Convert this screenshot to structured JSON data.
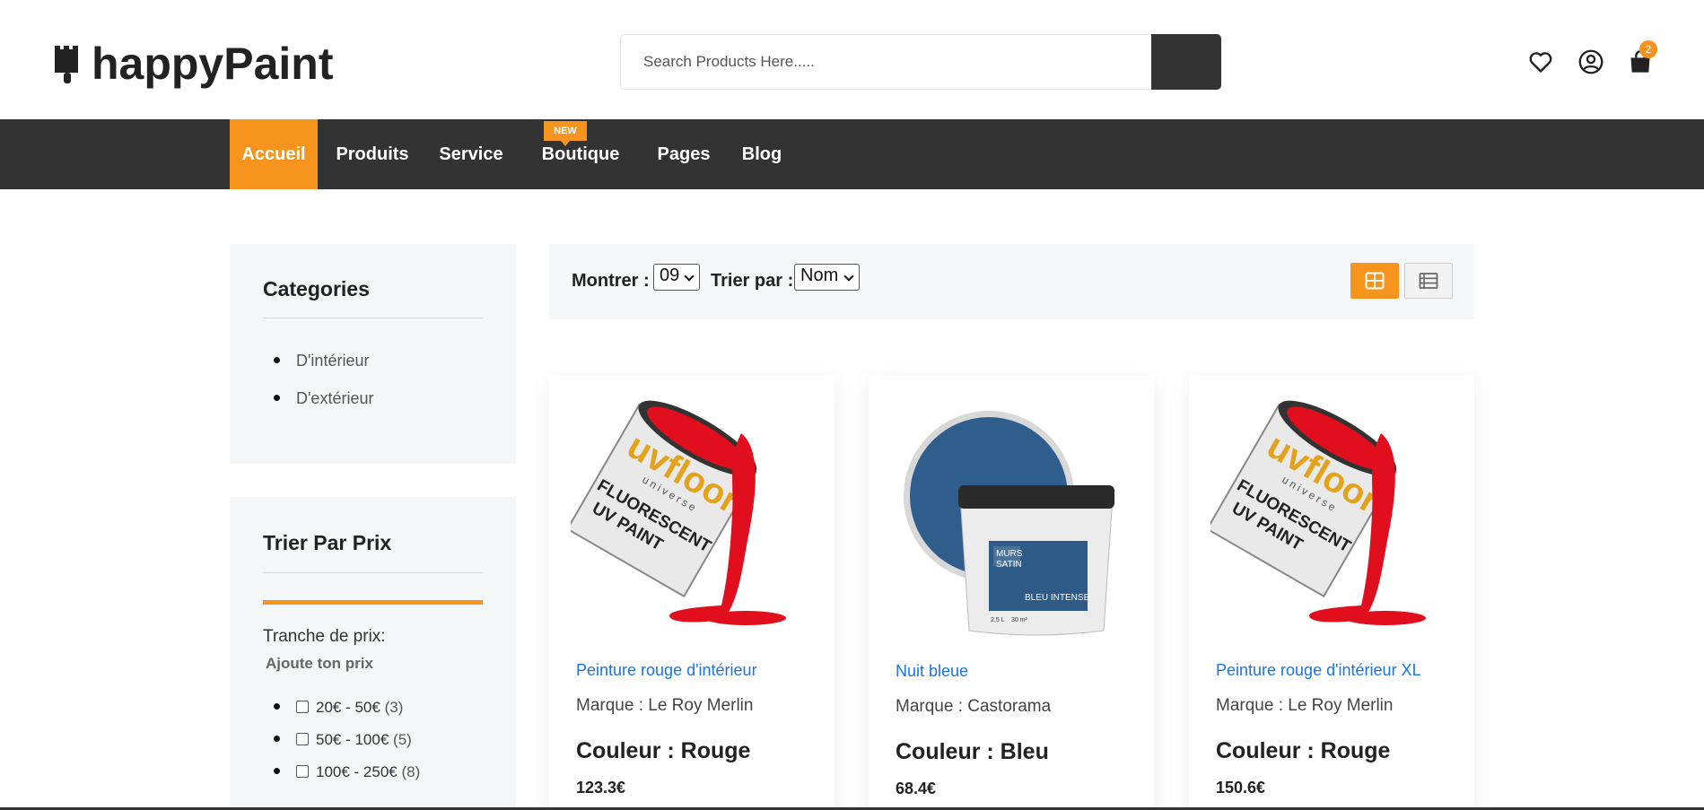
{
  "header": {
    "logo_text": "happyPaint",
    "search_placeholder": "Search Products Here.....",
    "cart_count": "2",
    "icons": [
      "heart-icon",
      "user-icon",
      "cart-icon"
    ]
  },
  "nav": {
    "items": [
      "Accueil",
      "Produits",
      "Service",
      "Boutique",
      "Pages",
      "Blog"
    ],
    "active": "Accueil",
    "new_badge": "NEW"
  },
  "sidebar": {
    "categories_title": "Categories",
    "categories": [
      "D'intérieur",
      "D'extérieur"
    ],
    "price_title": "Trier Par Prix",
    "price_range_label": "Tranche de prix:",
    "price_add_label": "Ajoute ton prix",
    "price_ranges": [
      {
        "label": "20€ - 50€",
        "count": "(3)"
      },
      {
        "label": "50€ - 100€",
        "count": "(5)"
      },
      {
        "label": "100€ - 250€",
        "count": "(8)"
      }
    ]
  },
  "toolbar": {
    "show_label": "Montrer :",
    "show_value": "09",
    "sort_label": "Trier par :",
    "sort_value": "Nom"
  },
  "products": [
    {
      "name": "Peinture rouge d'intérieur",
      "brand": "Marque : Le Roy Merlin",
      "color": "Couleur : Rouge",
      "price": "123.3€"
    },
    {
      "name": "Nuit bleue",
      "brand": "Marque : Castorama",
      "color": "Couleur : Bleu",
      "price": "68.4€"
    },
    {
      "name": "Peinture rouge d'intérieur XL",
      "brand": "Marque : Le Roy Merlin",
      "color": "Couleur : Rouge",
      "price": "150.6€"
    }
  ],
  "product_images": {
    "red_can_label_lines": [
      "uvfloor",
      "universe",
      "FLUORESCENT",
      "UV PAINT"
    ],
    "blue_bucket_label_lines": [
      "MURS",
      "SATIN",
      "BLEU INTENSE",
      "2,5 L",
      "30 m²"
    ]
  },
  "colors": {
    "accent": "#f7941d",
    "nav_bg": "#333333",
    "link": "#1a73e8",
    "panel_bg": "#f5f6f8"
  }
}
